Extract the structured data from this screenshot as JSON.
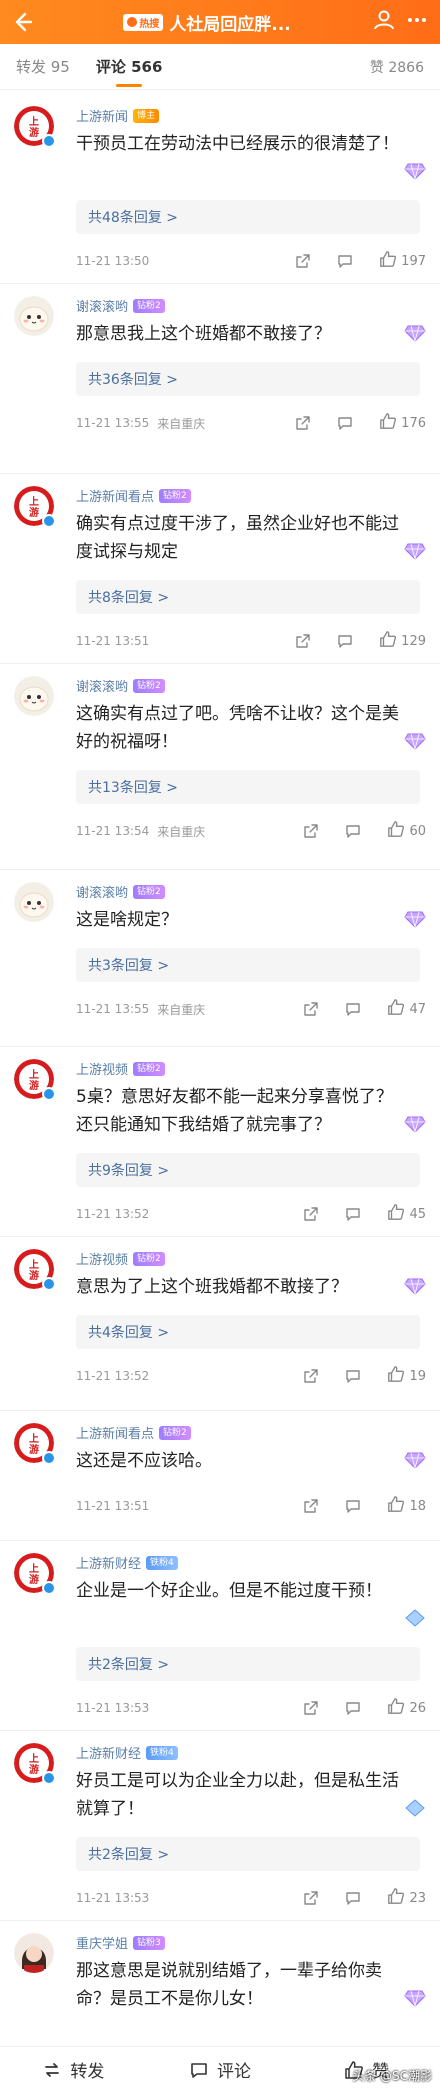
{
  "header": {
    "hot_label": "热搜",
    "title": "人社局回应胖..."
  },
  "tabs": {
    "repost": "转发 95",
    "comments": "评论 566",
    "likes": "赞 2866"
  },
  "comments": [
    {
      "user": "上游新闻",
      "badge": "博主",
      "text": "干预员工在劳动法中已经展示的很清楚了！",
      "replies": "共48条回复 >",
      "time": "11-21 13:50",
      "location": "",
      "likes": "197"
    },
    {
      "user": "谢滚滚哟",
      "badge": "钻粉2",
      "text": "那意思我上这个班婚都不敢接了？",
      "replies": "共36条回复 >",
      "time": "11-21 13:55",
      "location": "来自重庆",
      "likes": "176"
    },
    {
      "user": "上游新闻看点",
      "badge": "钻粉2",
      "text": "确实有点过度干涉了，虽然企业好也不能过度试探与规定",
      "replies": "共8条回复 >",
      "time": "11-21 13:51",
      "location": "",
      "likes": "129"
    },
    {
      "user": "谢滚滚哟",
      "badge": "钻粉2",
      "text": "这确实有点过了吧。凭啥不让收？这个是美好的祝福呀！",
      "replies": "共13条回复 >",
      "time": "11-21 13:54",
      "location": "来自重庆",
      "likes": "60"
    },
    {
      "user": "谢滚滚哟",
      "badge": "钻粉2",
      "text": "这是啥规定？",
      "replies": "共3条回复 >",
      "time": "11-21 13:55",
      "location": "来自重庆",
      "likes": "47"
    },
    {
      "user": "上游视频",
      "badge": "钻粉2",
      "text": "5桌？意思好友都不能一起来分享喜悦了？还只能通知下我结婚了就完事了？",
      "replies": "共9条回复 >",
      "time": "11-21 13:52",
      "location": "",
      "likes": "45"
    },
    {
      "user": "上游视频",
      "badge": "钻粉2",
      "text": "意思为了上这个班我婚都不敢接了？",
      "replies": "共4条回复 >",
      "time": "11-21 13:52",
      "location": "",
      "likes": "19"
    },
    {
      "user": "上游新闻看点",
      "badge": "钻粉2",
      "text": "这还是不应该哈。",
      "replies": "",
      "time": "11-21 13:51",
      "location": "",
      "likes": "18"
    },
    {
      "user": "上游新财经",
      "badge": "铁粉4",
      "text": "企业是一个好企业。但是不能过度干预！",
      "replies": "共2条回复 >",
      "time": "11-21 13:53",
      "location": "",
      "likes": "26"
    },
    {
      "user": "上游新财经",
      "badge": "铁粉4",
      "text": "好员工是可以为企业全力以赴，但是私生活就算了！",
      "replies": "共2条回复 >",
      "time": "11-21 13:53",
      "location": "",
      "likes": "23"
    },
    {
      "user": "重庆学姐",
      "badge": "钻粉3",
      "text": "那这意思是说就别结婚了，一辈子给你卖命？是员工不是你儿女！",
      "replies": "",
      "time": "",
      "location": "",
      "likes": ""
    }
  ],
  "bottom": {
    "repost": "转发",
    "comment": "评论",
    "like": "赞"
  },
  "watermark": "头条 @SC潮影",
  "colors": {
    "accent": "#ff8200",
    "link": "#4a6fa0"
  }
}
